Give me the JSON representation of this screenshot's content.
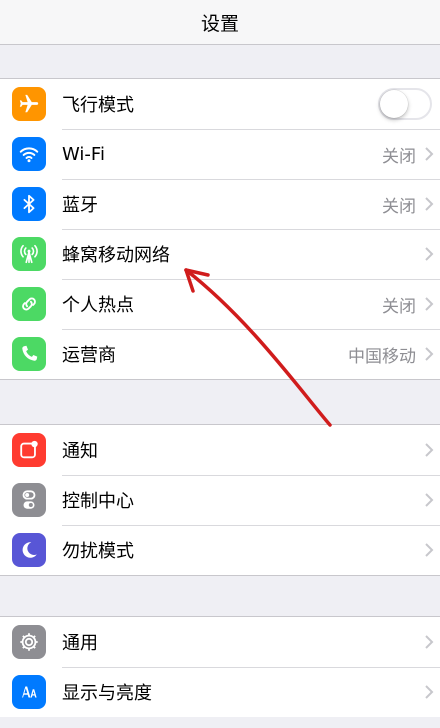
{
  "navbar": {
    "title": "设置"
  },
  "groups": [
    {
      "items": [
        {
          "label": "飞行模式",
          "value": "",
          "icon": "airplane-icon",
          "color": "#ff9500",
          "control": "toggle",
          "toggle_on": false
        },
        {
          "label": "Wi-Fi",
          "value": "关闭",
          "icon": "wifi-icon",
          "color": "#007aff",
          "control": "chevron"
        },
        {
          "label": "蓝牙",
          "value": "关闭",
          "icon": "bluetooth-icon",
          "color": "#007aff",
          "control": "chevron"
        },
        {
          "label": "蜂窝移动网络",
          "value": "",
          "icon": "cellular-icon",
          "color": "#4cd964",
          "control": "chevron"
        },
        {
          "label": "个人热点",
          "value": "关闭",
          "icon": "hotspot-icon",
          "color": "#4cd964",
          "control": "chevron"
        },
        {
          "label": "运营商",
          "value": "中国移动",
          "icon": "phone-icon",
          "color": "#4cd964",
          "control": "chevron"
        }
      ]
    },
    {
      "items": [
        {
          "label": "通知",
          "value": "",
          "icon": "notifications-icon",
          "color": "#ff3b30",
          "control": "chevron"
        },
        {
          "label": "控制中心",
          "value": "",
          "icon": "control-center-icon",
          "color": "#8e8e93",
          "control": "chevron"
        },
        {
          "label": "勿扰模式",
          "value": "",
          "icon": "moon-icon",
          "color": "#5856d6",
          "control": "chevron"
        }
      ]
    },
    {
      "items": [
        {
          "label": "通用",
          "value": "",
          "icon": "gear-icon",
          "color": "#8e8e93",
          "control": "chevron"
        },
        {
          "label": "显示与亮度",
          "value": "",
          "icon": "display-brightness-icon",
          "color": "#007aff",
          "control": "chevron"
        }
      ]
    }
  ],
  "annotation": {
    "color": "#d01c1c"
  }
}
